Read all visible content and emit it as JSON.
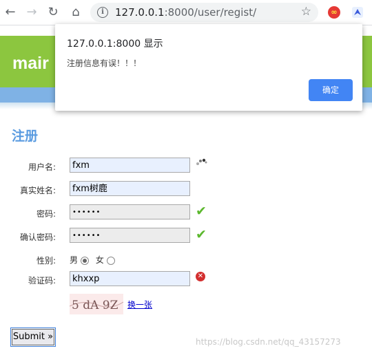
{
  "browser": {
    "back_icon": "back-arrow-icon",
    "forward_icon": "forward-arrow-icon",
    "reload_icon": "reload-icon",
    "home_icon": "home-icon",
    "url_host": "127.0.0.1",
    "url_port_path": ":8000/user/regist/",
    "bookmark_icon": "star-icon"
  },
  "page": {
    "logo": "mair",
    "form_title": "注册",
    "fields": {
      "username_label": "用户名:",
      "username_value": "fxm",
      "realname_label": "真实姓名:",
      "realname_value": "fxm树鹿",
      "password_label": "密码:",
      "password_value": "••••••",
      "confirm_label": "确认密码:",
      "confirm_value": "••••••",
      "gender_label": "性别:",
      "gender_male": "男",
      "gender_female": "女",
      "gender_selected": "男",
      "captcha_label": "验证码:",
      "captcha_value": "khxxp",
      "captcha_image_text": "5 dA 9Z",
      "change_link": "换一张"
    },
    "submit_label": "Submit »",
    "watermark": "https://blog.csdn.net/qq_43157273"
  },
  "dialog": {
    "title": "127.0.0.1:8000 显示",
    "message": "注册信息有误！！！",
    "ok_label": "确定"
  },
  "colors": {
    "banner": "#8cc63f",
    "navbar": "#7fb2e5",
    "title": "#5a9be0",
    "check": "#5cb82e",
    "error": "#d32f2f",
    "dialog_button": "#4285f4"
  }
}
